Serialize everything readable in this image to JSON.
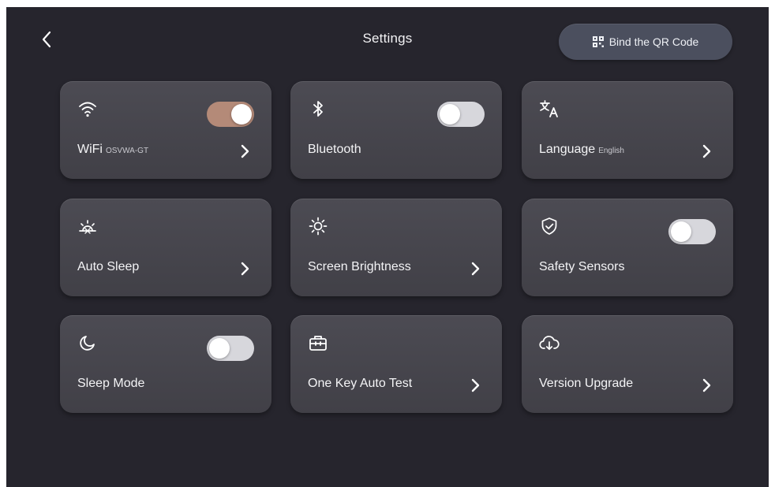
{
  "header": {
    "title": "Settings",
    "qr_button_label": "Bind the QR Code"
  },
  "colors": {
    "background": "#26252d",
    "card": "#46454c",
    "toggle_on": "#b48a78",
    "toggle_off": "#d7d7dc"
  },
  "cards": [
    {
      "label": "WiFi",
      "sub": "OSVWA-GT",
      "icon": "wifi-icon",
      "control": "toggle",
      "toggle_state": "on",
      "has_chevron": true
    },
    {
      "label": "Bluetooth",
      "icon": "bluetooth-icon",
      "control": "toggle",
      "toggle_state": "off",
      "has_chevron": false
    },
    {
      "label": "Language",
      "sub": "English",
      "icon": "translate-icon",
      "has_chevron": true
    },
    {
      "label": "Auto Sleep",
      "icon": "auto-sleep-icon",
      "has_chevron": true
    },
    {
      "label": "Screen Brightness",
      "icon": "brightness-icon",
      "has_chevron": true
    },
    {
      "label": "Safety Sensors",
      "icon": "shield-check-icon",
      "control": "toggle",
      "toggle_state": "off",
      "has_chevron": false
    },
    {
      "label": "Sleep Mode",
      "icon": "moon-icon",
      "control": "toggle",
      "toggle_state": "off",
      "has_chevron": false
    },
    {
      "label": "One Key Auto Test",
      "icon": "toolbox-icon",
      "has_chevron": true
    },
    {
      "label": "Version Upgrade",
      "icon": "cloud-download-icon",
      "has_chevron": true
    }
  ]
}
